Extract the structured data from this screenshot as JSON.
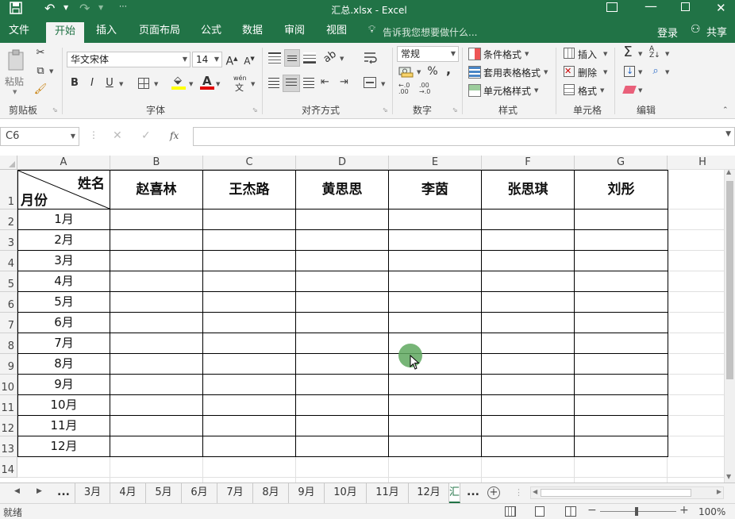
{
  "window": {
    "title": "汇总.xlsx - Excel",
    "controls": [
      "?",
      "—",
      "☐",
      "✕"
    ]
  },
  "quick_access": {
    "save_icon": "save-icon",
    "undo_icon": "undo-icon",
    "redo_icon": "redo-icon",
    "customize_icon": "customize-icon"
  },
  "ribbon_tabs": [
    "文件",
    "开始",
    "插入",
    "页面布局",
    "公式",
    "数据",
    "审阅",
    "视图"
  ],
  "active_tab": "开始",
  "tell_me": "告诉我您想要做什么...",
  "signin": "登录",
  "share": "共享",
  "ribbon": {
    "clipboard": {
      "label": "剪贴板",
      "paste": "粘贴"
    },
    "font": {
      "label": "字体",
      "font_name": "华文宋体",
      "font_size": "14",
      "grow": "A",
      "shrink": "A",
      "bold": "B",
      "italic": "I",
      "underline": "U",
      "wen_label": "wén",
      "wen_char": "文"
    },
    "alignment": {
      "label": "对齐方式"
    },
    "number": {
      "label": "数字",
      "format": "常规",
      "percent": "%",
      "comma": ",",
      "inc_decimal": "←.0\n.00",
      "dec_decimal": ".00\n→.0"
    },
    "styles": {
      "label": "样式",
      "conditional": "条件格式",
      "table": "套用表格格式",
      "cell_styles": "单元格样式"
    },
    "cells": {
      "label": "单元格",
      "insert": "插入",
      "delete": "删除",
      "format": "格式"
    },
    "editing": {
      "label": "编辑"
    }
  },
  "formula_bar": {
    "name_box": "C6",
    "fx": "fx",
    "content": ""
  },
  "columns": [
    "A",
    "B",
    "C",
    "D",
    "E",
    "F",
    "G",
    "H"
  ],
  "rows": [
    "1",
    "2",
    "3",
    "4",
    "5",
    "6",
    "7",
    "8",
    "9",
    "10",
    "11",
    "12",
    "13",
    "14"
  ],
  "table": {
    "header_top": "姓名",
    "header_bottom": "月份",
    "names": [
      "赵喜林",
      "王杰路",
      "黄思思",
      "李茵",
      "张思琪",
      "刘彤"
    ],
    "months": [
      "1月",
      "2月",
      "3月",
      "4月",
      "5月",
      "6月",
      "7月",
      "8月",
      "9月",
      "10月",
      "11月",
      "12月"
    ]
  },
  "sheet_tabs": {
    "ellipsis_left": "...",
    "tabs": [
      "3月",
      "4月",
      "5月",
      "6月",
      "7月",
      "8月",
      "9月",
      "10月",
      "11月",
      "12月"
    ],
    "active_partial": "汇",
    "ellipsis_right": "..."
  },
  "status": {
    "ready": "就绪",
    "zoom": "100%"
  },
  "colors": {
    "excel_green": "#217346",
    "ribbon_bg": "#f3f3f3",
    "cursor_highlight": "#5fa85f"
  }
}
